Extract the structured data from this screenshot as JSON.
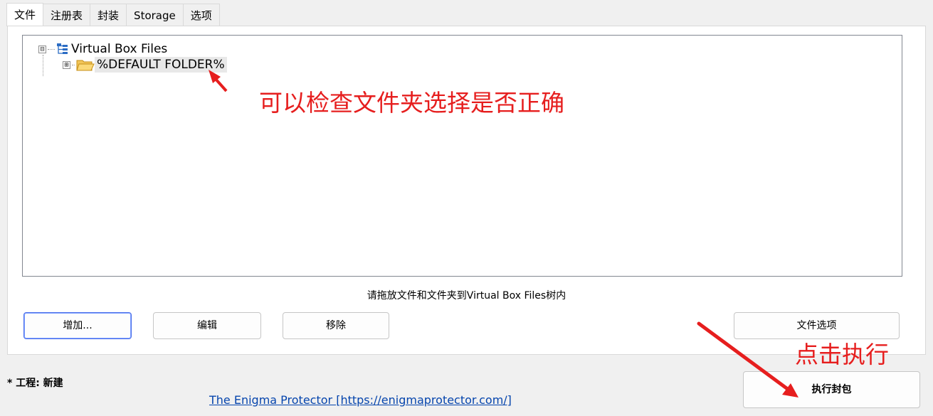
{
  "tabs": [
    {
      "label": "文件",
      "active": true
    },
    {
      "label": "注册表",
      "active": false
    },
    {
      "label": "封装",
      "active": false
    },
    {
      "label": "Storage",
      "active": false
    },
    {
      "label": "选项",
      "active": false
    }
  ],
  "tree": {
    "root": {
      "label": "Virtual Box Files",
      "icon": "tree-structure-icon",
      "expander": "⊟"
    },
    "child": {
      "label": "%DEFAULT FOLDER%",
      "icon": "folder-icon",
      "expander": "⊞"
    }
  },
  "hint": "请拖放文件和文件夹到Virtual Box Files树内",
  "buttons": {
    "add": "增加...",
    "edit": "编辑",
    "remove": "移除",
    "file_options": "文件选项",
    "execute": "执行封包"
  },
  "status": {
    "text": "* 工程: 新建"
  },
  "footer_link": "The Enigma Protector [https://enigmaprotector.com/]",
  "annotations": {
    "check_folder": "可以检查文件夹选择是否正确",
    "click_execute": "点击执行",
    "color": "#e61e1e"
  }
}
